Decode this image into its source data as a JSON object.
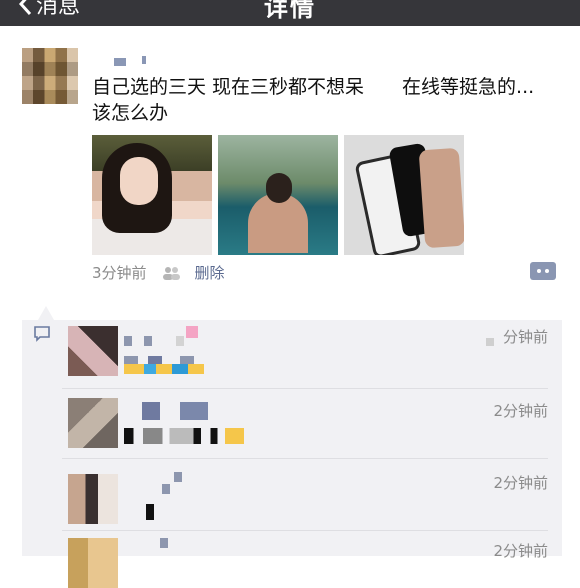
{
  "header": {
    "back_label": "消息",
    "title": "详情"
  },
  "post": {
    "text": "自己选的三天 现在三秒都不想呆　　在线等挺急的...该怎么办",
    "time": "3分钟前",
    "delete_label": "删除",
    "photos": [
      "photo-1",
      "photo-2",
      "photo-3"
    ]
  },
  "comments": [
    {
      "time": "分钟前"
    },
    {
      "time": "2分钟前"
    },
    {
      "time": "2分钟前"
    },
    {
      "time": "2分钟前"
    }
  ],
  "icons": {
    "back": "chevron-left-icon",
    "people": "people-icon",
    "more": "more-icon",
    "comment": "comment-icon"
  },
  "colors": {
    "topbar": "#36363a",
    "link": "#5b6a90",
    "comment_bg": "#f1f1f4"
  }
}
